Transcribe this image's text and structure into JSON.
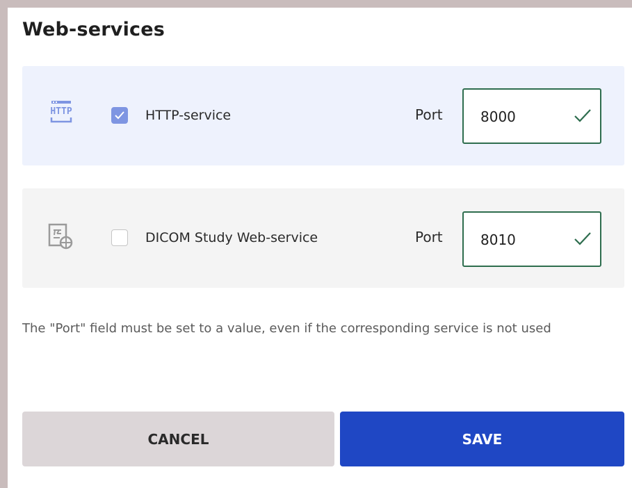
{
  "header": {
    "title": "Web-services"
  },
  "services": [
    {
      "icon": "http-icon",
      "icon_text": "HTTP",
      "checked": true,
      "label": "HTTP-service",
      "port_label": "Port",
      "port_value": "8000",
      "port_valid": true
    },
    {
      "icon": "dicom-study-icon",
      "checked": false,
      "label": "DICOM Study Web-service",
      "port_label": "Port",
      "port_value": "8010",
      "port_valid": true
    }
  ],
  "note": "The \"Port\" field must be set to a value, even if the corresponding service is not used",
  "buttons": {
    "cancel_label": "CANCEL",
    "save_label": "SAVE"
  },
  "colors": {
    "accent": "#1f47c4",
    "checkbox_checked": "#7e95e2",
    "valid_green": "#2e6d4e",
    "card_active_bg": "#eef2fd",
    "card_inactive_bg": "#f4f4f4"
  }
}
